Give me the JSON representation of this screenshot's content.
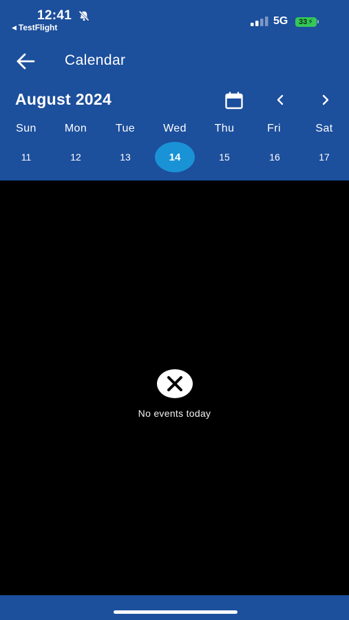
{
  "status_bar": {
    "time": "12:41",
    "back_app": "TestFlight",
    "network": "5G",
    "battery": "33"
  },
  "app_bar": {
    "title": "Calendar"
  },
  "calendar": {
    "month_title": "August 2024",
    "weekdays": [
      "Sun",
      "Mon",
      "Tue",
      "Wed",
      "Thu",
      "Fri",
      "Sat"
    ],
    "days": [
      "11",
      "12",
      "13",
      "14",
      "15",
      "16",
      "17"
    ],
    "selected_day": "14"
  },
  "empty_state": {
    "message": "No events today"
  },
  "colors": {
    "header_blue": "#1c4f9c",
    "selected_day": "#1a93d6",
    "battery_green": "#34c759",
    "background": "#000000"
  }
}
